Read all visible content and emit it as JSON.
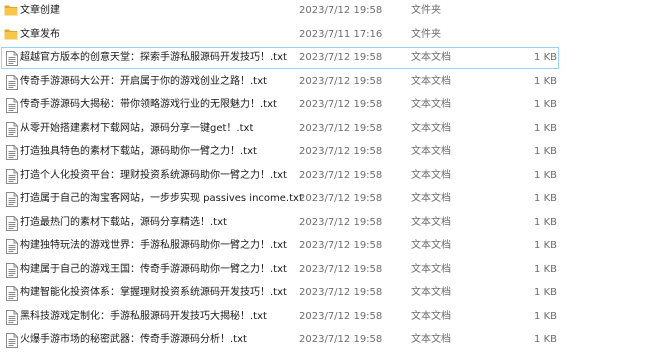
{
  "files": [
    {
      "icon": "folder-icon",
      "name": "文章创建",
      "date": "2023/7/12 19:58",
      "type": "文件夹",
      "size": ""
    },
    {
      "icon": "folder-icon",
      "name": "文章发布",
      "date": "2023/7/11 17:16",
      "type": "文件夹",
      "size": ""
    },
    {
      "icon": "text-file-icon",
      "name": "超越官方版本的创意天堂：探索手游私服源码开发技巧！.txt",
      "date": "2023/7/12 19:58",
      "type": "文本文档",
      "size": "1 KB",
      "selected": true
    },
    {
      "icon": "text-file-icon",
      "name": "传奇手游源码大公开：开启属于你的游戏创业之路！.txt",
      "date": "2023/7/12 19:58",
      "type": "文本文档",
      "size": "1 KB"
    },
    {
      "icon": "text-file-icon",
      "name": "传奇手游源码大揭秘：带你领略游戏行业的无限魅力！.txt",
      "date": "2023/7/12 19:58",
      "type": "文本文档",
      "size": "1 KB"
    },
    {
      "icon": "text-file-icon",
      "name": "从零开始搭建素材下载网站，源码分享一键get！.txt",
      "date": "2023/7/12 19:58",
      "type": "文本文档",
      "size": "1 KB"
    },
    {
      "icon": "text-file-icon",
      "name": "打造独具特色的素材下载站，源码助你一臂之力！.txt",
      "date": "2023/7/12 19:58",
      "type": "文本文档",
      "size": "1 KB"
    },
    {
      "icon": "text-file-icon",
      "name": "打造个人化投资平台：理财投资系统源码助你一臂之力！.txt",
      "date": "2023/7/12 19:58",
      "type": "文本文档",
      "size": "1 KB"
    },
    {
      "icon": "text-file-icon",
      "name": "打造属于自己的淘宝客网站，一步步实现 passives income.txt",
      "date": "2023/7/12 19:58",
      "type": "文本文档",
      "size": "1 KB"
    },
    {
      "icon": "text-file-icon",
      "name": "打造最热门的素材下载站，源码分享精选！.txt",
      "date": "2023/7/12 19:58",
      "type": "文本文档",
      "size": "1 KB"
    },
    {
      "icon": "text-file-icon",
      "name": "构建独特玩法的游戏世界：手游私服源码助你一臂之力！.txt",
      "date": "2023/7/12 19:58",
      "type": "文本文档",
      "size": "1 KB"
    },
    {
      "icon": "text-file-icon",
      "name": "构建属于自己的游戏王国：传奇手游源码助你一臂之力！.txt",
      "date": "2023/7/12 19:58",
      "type": "文本文档",
      "size": "1 KB"
    },
    {
      "icon": "text-file-icon",
      "name": "构建智能化投资体系：掌握理财投资系统源码开发技巧！.txt",
      "date": "2023/7/12 19:58",
      "type": "文本文档",
      "size": "1 KB"
    },
    {
      "icon": "text-file-icon",
      "name": "黑科技游戏定制化：手游私服源码开发技巧大揭秘！.txt",
      "date": "2023/7/12 19:58",
      "type": "文本文档",
      "size": "1 KB"
    },
    {
      "icon": "text-file-icon",
      "name": "火爆手游市场的秘密武器：传奇手游源码分析！.txt",
      "date": "2023/7/12 19:58",
      "type": "文本文档",
      "size": "1 KB"
    }
  ],
  "colors": {
    "folder": "#f8c74a",
    "folder_dark": "#e3a72d",
    "selection_border": "#99d1ff",
    "secondary_text": "#6d6d6d"
  }
}
